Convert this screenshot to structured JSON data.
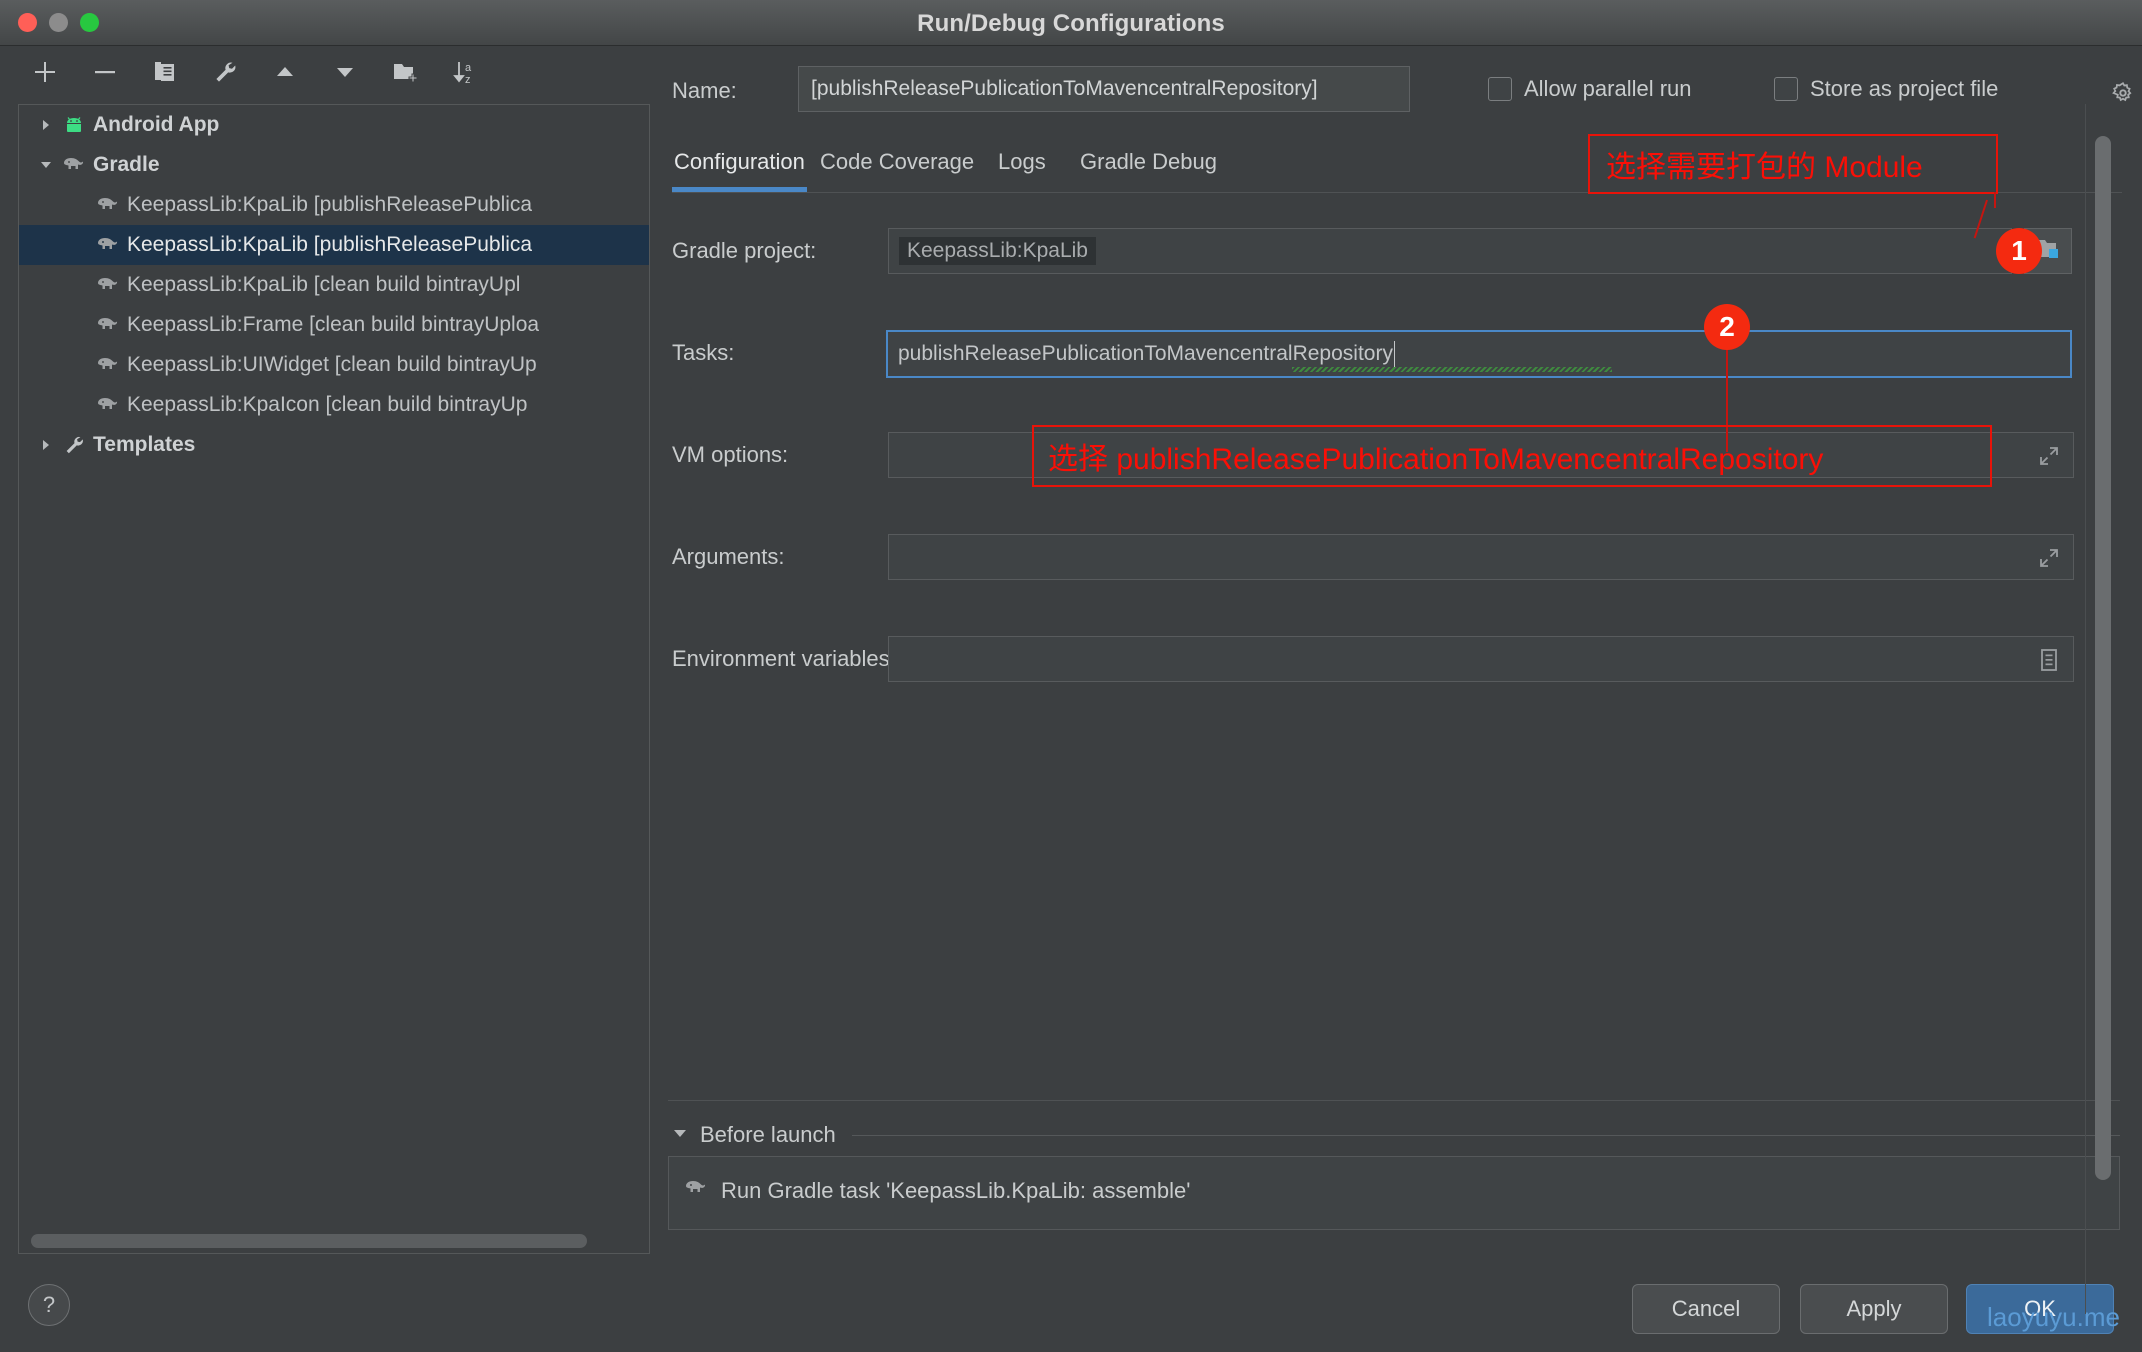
{
  "window": {
    "title": "Run/Debug Configurations",
    "traffic_lights": [
      "close-red",
      "minimize-gray",
      "zoom-green"
    ]
  },
  "left_toolbar": {
    "buttons": [
      {
        "name": "add-configuration-button",
        "icon": "plus-icon",
        "tooltip": "Add New Configuration"
      },
      {
        "name": "remove-configuration-button",
        "icon": "minus-icon",
        "tooltip": "Remove Configuration"
      },
      {
        "name": "copy-configuration-button",
        "icon": "copy-icon",
        "tooltip": "Copy Configuration"
      },
      {
        "name": "edit-templates-button",
        "icon": "wrench-icon",
        "tooltip": "Edit Templates"
      },
      {
        "name": "move-up-button",
        "icon": "triangle-up-icon",
        "tooltip": "Move Up"
      },
      {
        "name": "move-down-button",
        "icon": "triangle-down-icon",
        "tooltip": "Move Down"
      },
      {
        "name": "new-folder-button",
        "icon": "folder-plus-icon",
        "tooltip": "Create New Folder"
      },
      {
        "name": "sort-button",
        "icon": "sort-az-icon",
        "tooltip": "Sort Configurations"
      }
    ]
  },
  "tree": {
    "items": [
      {
        "label": "Android App",
        "level": 0,
        "icon": "android-icon",
        "arrow": "collapsed",
        "selected": false,
        "bold": true
      },
      {
        "label": "Gradle",
        "level": 0,
        "icon": "gradle-elephant-icon",
        "arrow": "expanded",
        "selected": false,
        "bold": true
      },
      {
        "label": "KeepassLib:KpaLib [publishReleasePublica",
        "level": 1,
        "icon": "gradle-elephant-icon",
        "arrow": "none",
        "selected": false,
        "bold": false
      },
      {
        "label": "KeepassLib:KpaLib [publishReleasePublica",
        "level": 1,
        "icon": "gradle-elephant-icon",
        "arrow": "none",
        "selected": true,
        "bold": false
      },
      {
        "label": "KeepassLib:KpaLib [clean build bintrayUpl",
        "level": 1,
        "icon": "gradle-elephant-icon",
        "arrow": "none",
        "selected": false,
        "bold": false
      },
      {
        "label": "KeepassLib:Frame [clean build bintrayUploa",
        "level": 1,
        "icon": "gradle-elephant-icon",
        "arrow": "none",
        "selected": false,
        "bold": false
      },
      {
        "label": "KeepassLib:UIWidget [clean build bintrayUp",
        "level": 1,
        "icon": "gradle-elephant-icon",
        "arrow": "none",
        "selected": false,
        "bold": false
      },
      {
        "label": "KeepassLib:KpaIcon [clean build bintrayUp",
        "level": 1,
        "icon": "gradle-elephant-icon",
        "arrow": "none",
        "selected": false,
        "bold": false
      },
      {
        "label": "Templates",
        "level": 0,
        "icon": "wrench-icon",
        "arrow": "collapsed",
        "selected": false,
        "bold": true
      }
    ]
  },
  "help": {
    "label": "?"
  },
  "name_row": {
    "label": "Name:",
    "value": "[publishReleasePublicationToMavencentralRepository]",
    "placeholder": "Name",
    "allow_parallel_run": {
      "label": "Allow parallel run",
      "checked": false
    },
    "store_as_project_file": {
      "label": "Store as project file",
      "checked": false
    },
    "gear_icon": "gear-icon"
  },
  "tabs": [
    {
      "label": "Configuration",
      "active": true
    },
    {
      "label": "Code Coverage",
      "active": false
    },
    {
      "label": "Logs",
      "active": false
    },
    {
      "label": "Gradle Debug",
      "active": false
    }
  ],
  "form": {
    "gradle_project": {
      "label": "Gradle project:",
      "value": "KeepassLib:KpaLib",
      "browse_icon": "folder-browse-icon"
    },
    "tasks": {
      "label": "Tasks:",
      "value": "publishReleasePublicationToMavencentralRepository",
      "has_spellcheck_squiggle": true,
      "focused": true
    },
    "vm_options": {
      "label": "VM options:",
      "value": "",
      "expand_icon": "expand-arrows-icon"
    },
    "arguments": {
      "label": "Arguments:",
      "value": "",
      "expand_icon": "expand-arrows-icon"
    },
    "environment_variables": {
      "label": "Environment variables:",
      "value": "",
      "edit_icon": "list-edit-icon"
    }
  },
  "annotations": {
    "note_module": "选择需要打包的 Module",
    "note_task": "选择 publishReleasePublicationToMavencentralRepository",
    "badge_1": "1",
    "badge_2": "2",
    "color": "#f42a10"
  },
  "before_launch": {
    "title": "Before launch",
    "collapse_icon": "triangle-down-icon",
    "items": [
      {
        "icon": "gradle-elephant-icon",
        "label": "Run Gradle task 'KeepassLib.KpaLib: assemble'"
      }
    ]
  },
  "footer": {
    "cancel": "Cancel",
    "apply": "Apply",
    "ok": "OK",
    "watermark": "laoyuyu.me"
  }
}
